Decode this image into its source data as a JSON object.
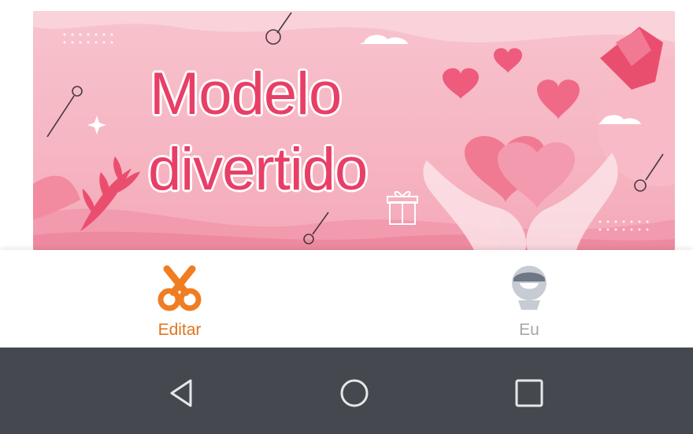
{
  "banner": {
    "title_line1": "Modelo",
    "title_line2": "divertido"
  },
  "tabbar": {
    "tabs": [
      {
        "label": "Editar",
        "icon": "scissors-icon",
        "active": true,
        "color": "#e0751f"
      },
      {
        "label": "Eu",
        "icon": "profile-avatar-icon",
        "active": false,
        "color": "#a3a6ab"
      }
    ]
  },
  "navbar": {
    "buttons": [
      "back-icon",
      "home-icon",
      "recent-apps-icon"
    ],
    "background": "#45494f"
  }
}
